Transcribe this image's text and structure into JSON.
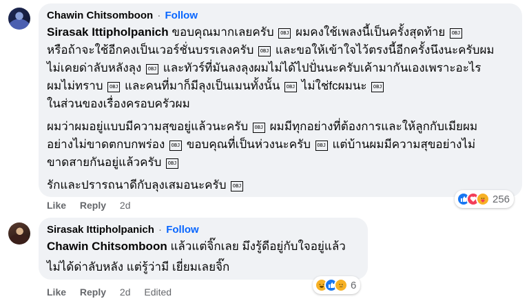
{
  "comments": [
    {
      "author": "Chawin Chitsomboon",
      "follow_label": "Follow",
      "separator": "·",
      "lines": [
        {
          "mention": "Sirasak Ittipholpanich",
          "segments": [
            " ขอบคุณมากเลยครับ ",
            "OBJ",
            " ผมคงใช้เพลงนี้เป็นครั้งสุดท้าย ",
            "OBJ"
          ]
        },
        {
          "segments": [
            "หรือถ้าจะใช้อีกคงเป็นเวอร์ชั่นบรรเลงครับ ",
            "OBJ",
            " และขอให้เข้าใจไว้ตรงนี้อีกครั้งนึงนะครับผม"
          ]
        },
        {
          "segments": [
            "ไม่เคยด่าลับหลังลุง ",
            "OBJ",
            " และทัวร์ที่มันลงลุงผมไม่ได้ไปปั่นนะครับเค้ามากันเองเพราะอะไร"
          ]
        },
        {
          "segments": [
            "ผมไม่ทราบ ",
            "OBJ",
            " และคนที่มาก็มีลุงเป็นเมนทั้งนั้น ",
            "OBJ",
            " ไม่ใช่fcผมนะ ",
            "OBJ"
          ]
        },
        {
          "segments": [
            "ในส่วนของเรื่องครอบครัวผม"
          ]
        },
        {
          "segments": [
            "ผมว่าผมอยู่แบบมีความสุขอยู่แล้วนะครับ ",
            "OBJ",
            " ผมมีทุกอย่างที่ต้องการและให้ลูกกับเมียผม"
          ]
        },
        {
          "segments": [
            "อย่างไม่ขาดตกบกพร่อง ",
            "OBJ",
            " ขอบคุณที่เป็นห่วงนะครับ ",
            "OBJ",
            " แต่บ้านผมมีความสุขอย่างไม่"
          ]
        },
        {
          "segments": [
            "ขาดสายกันอยู่แล้วครับ ",
            "OBJ"
          ]
        },
        {
          "segments": [
            "รักและปรารถนาดีกับลุงเสมอนะครับ ",
            "OBJ"
          ]
        }
      ],
      "actions": {
        "like": "Like",
        "reply": "Reply",
        "time": "2d"
      },
      "reaction_count": "256",
      "reaction_icons": [
        "like-icon",
        "love-icon",
        "care-icon"
      ]
    },
    {
      "author": "Sirasak Ittipholpanich",
      "follow_label": "Follow",
      "separator": "·",
      "lines": [
        {
          "mention": "Chawin Chitsomboon",
          "segments": [
            " แล้วแต่จิ๊กเลย มึงรู้ดีอยู่กับใจอยู่แล้ว"
          ]
        },
        {
          "segments": [
            "ไม่ได้ด่าลับหลัง แต่รู้ว่ามี เยี่ยมเลยจิ๊ก"
          ]
        }
      ],
      "actions": {
        "like": "Like",
        "reply": "Reply",
        "time": "2d",
        "edited": "Edited"
      },
      "reaction_count": "6",
      "reaction_icons": [
        "haha-icon",
        "like-icon",
        "sad-icon"
      ]
    }
  ],
  "colors": {
    "follow": "#0866ff",
    "bubble": "#f0f2f5",
    "meta": "#65676b"
  }
}
